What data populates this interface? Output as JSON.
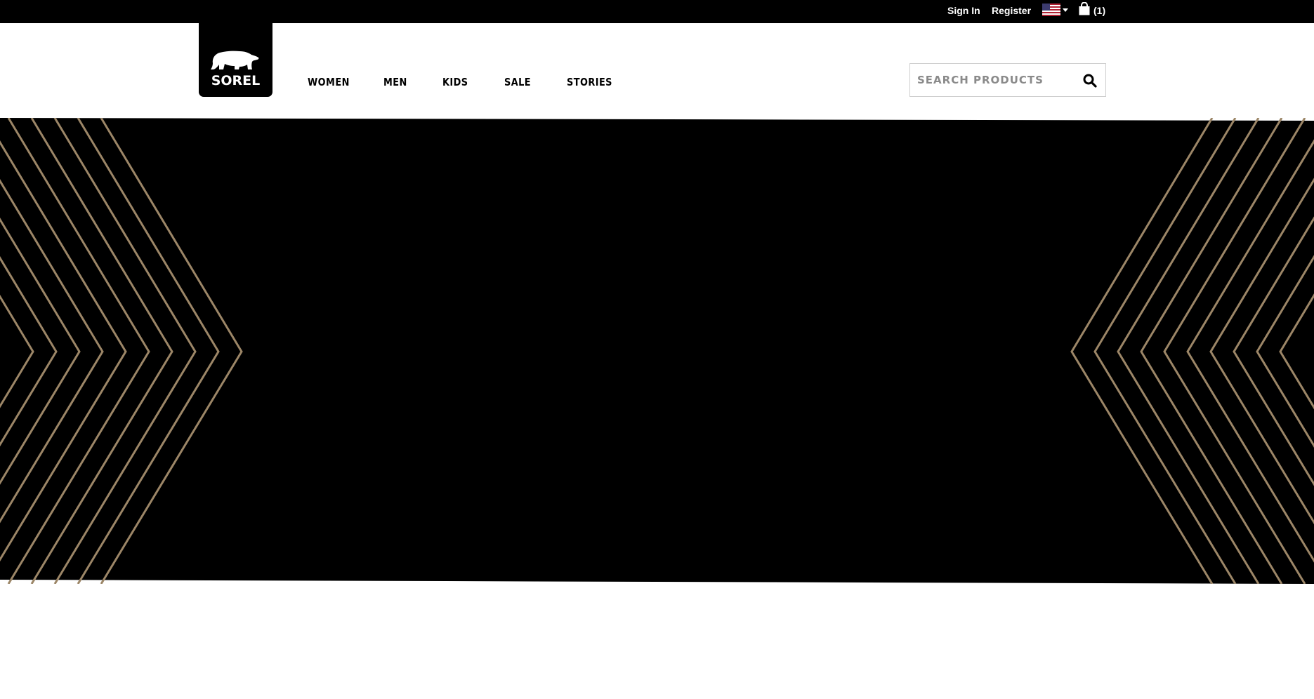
{
  "utility_bar": {
    "sign_in": "Sign In",
    "register": "Register",
    "locale_flag": "us-flag-icon",
    "cart_icon": "shopping-bag-icon",
    "cart_count": "(1)"
  },
  "header": {
    "logo_text": "SOREL",
    "nav": [
      "WOMEN",
      "MEN",
      "KIDS",
      "SALE",
      "STORIES"
    ],
    "search": {
      "placeholder": "SEARCH PRODUCTS",
      "value": "",
      "icon": "search-icon"
    }
  },
  "hero": {
    "background": "#000000",
    "line_color": "#9c8667",
    "decoration": "chevron-lines"
  },
  "colors": {
    "topbar": "#000000",
    "text_light": "#ffffff",
    "text_dark": "#000000"
  }
}
